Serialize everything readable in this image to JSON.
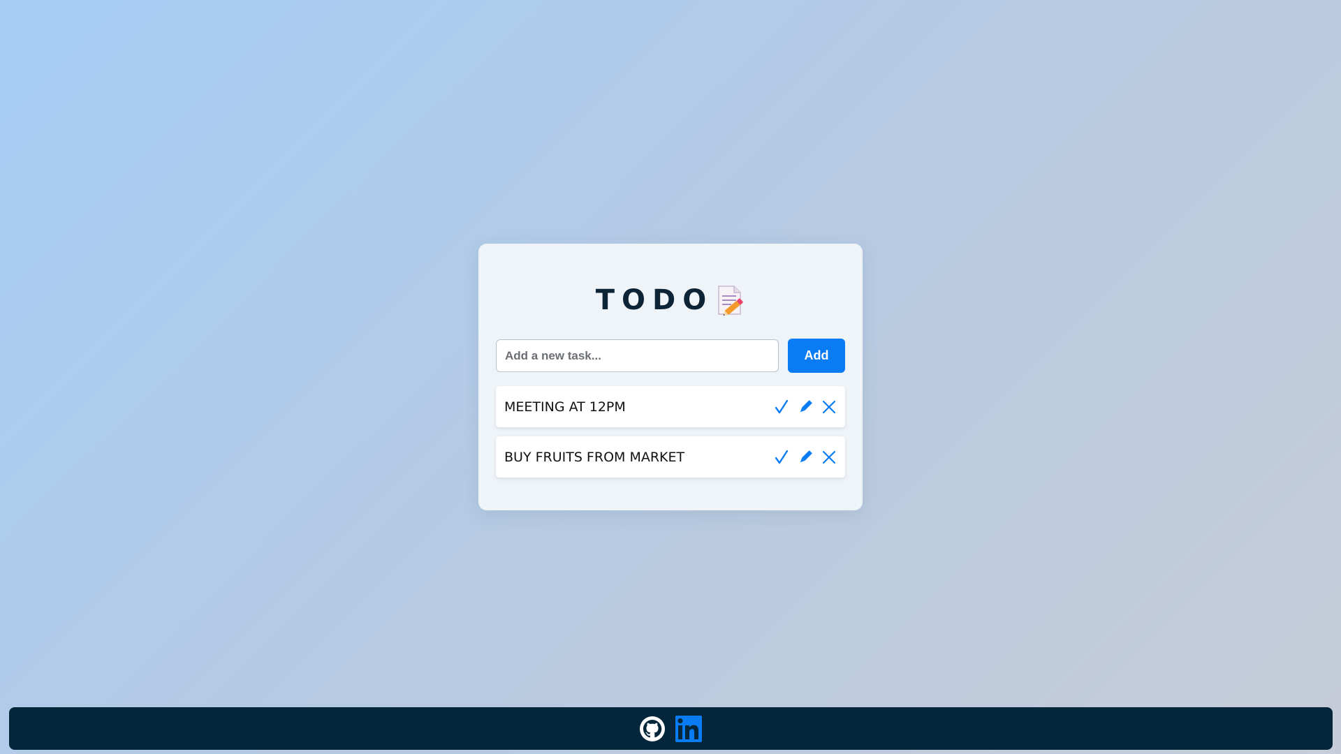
{
  "app": {
    "title": "TODO",
    "title_icon": "memo-icon"
  },
  "input": {
    "placeholder": "Add a new task...",
    "value": ""
  },
  "add_button": {
    "label": "Add"
  },
  "tasks": [
    {
      "text": "MEETING AT 12PM"
    },
    {
      "text": "BUY FRUITS FROM MARKET"
    }
  ],
  "task_action_icons": [
    "check-icon",
    "edit-pencil-icon",
    "delete-x-icon"
  ],
  "footer": {
    "links": [
      {
        "icon": "github-icon"
      },
      {
        "icon": "linkedin-icon"
      }
    ]
  },
  "colors": {
    "accent": "#0a7cf3",
    "title": "#0d2336",
    "footer_bg": "#04263a",
    "card_bg": "#eff4f9"
  }
}
